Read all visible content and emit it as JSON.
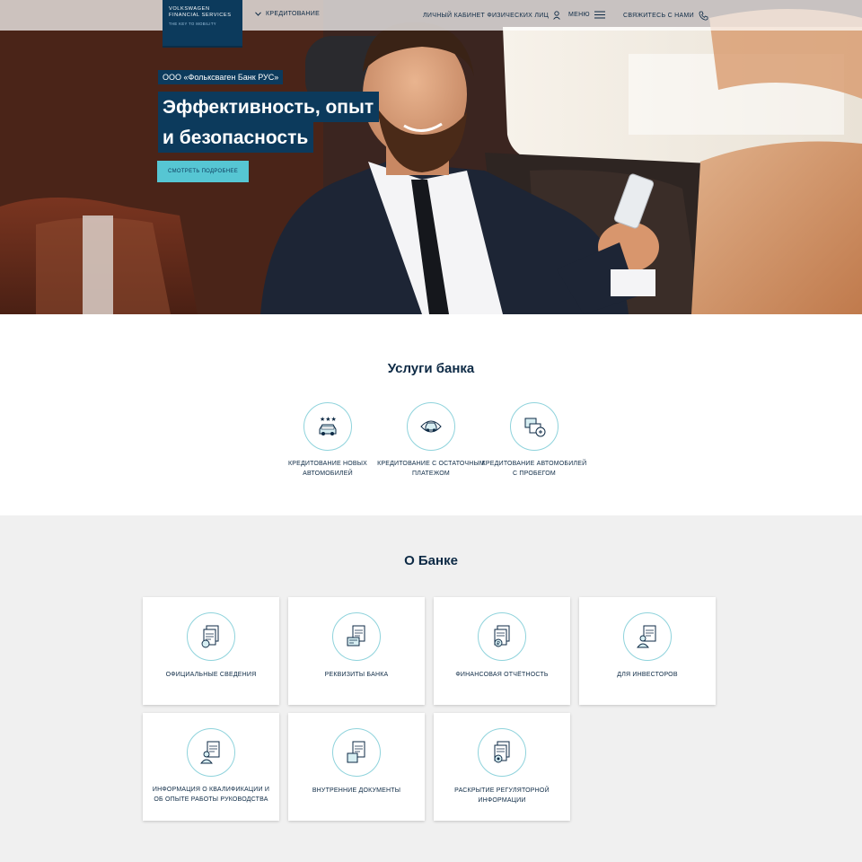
{
  "header": {
    "logo_lines": [
      "VOLKSWAGEN",
      "FINANCIAL SERVICES"
    ],
    "logo_tagline": "THE KEY TO MOBILITY",
    "nav": {
      "credit": "Кредитование",
      "cabinet": "Личный кабинет физических лиц",
      "menu": "Меню",
      "contact": "Свяжитесь с нами"
    }
  },
  "hero": {
    "tag": "ООО «Фольксваген Банк РУС»",
    "headline_line1": "Эффективность, опыт",
    "headline_line2": "и безопасность",
    "button": "Смотреть подробнее"
  },
  "services": {
    "title": "Услуги банка",
    "items": [
      {
        "label": "Кредитование новых автомобилей",
        "icon": "new-car-icon"
      },
      {
        "label": "Кредитование с остаточным платежом",
        "icon": "residual-payment-car-icon"
      },
      {
        "label": "Кредитование автомобилей с пробегом",
        "icon": "used-car-icon"
      }
    ]
  },
  "about": {
    "title": "О Банке",
    "cards": [
      {
        "label": "Официальные сведения",
        "icon": "official-document-icon"
      },
      {
        "label": "Реквизиты банка",
        "icon": "bank-details-icon"
      },
      {
        "label": "Финансовая отчётность",
        "icon": "financial-report-icon"
      },
      {
        "label": "Для инвесторов",
        "icon": "investors-icon"
      },
      {
        "label": "Информация о квалификации и об опыте работы руководства",
        "icon": "management-info-icon"
      },
      {
        "label": "Внутренние документы",
        "icon": "internal-documents-icon"
      },
      {
        "label": "Раскрытие регуляторной информации",
        "icon": "regulatory-disclosure-icon"
      }
    ]
  },
  "colors": {
    "brand_navy": "#0c3a5c",
    "accent_teal": "#56c6d3",
    "icon_ring": "#8fd3dc",
    "about_bg": "#f0f0f0"
  }
}
